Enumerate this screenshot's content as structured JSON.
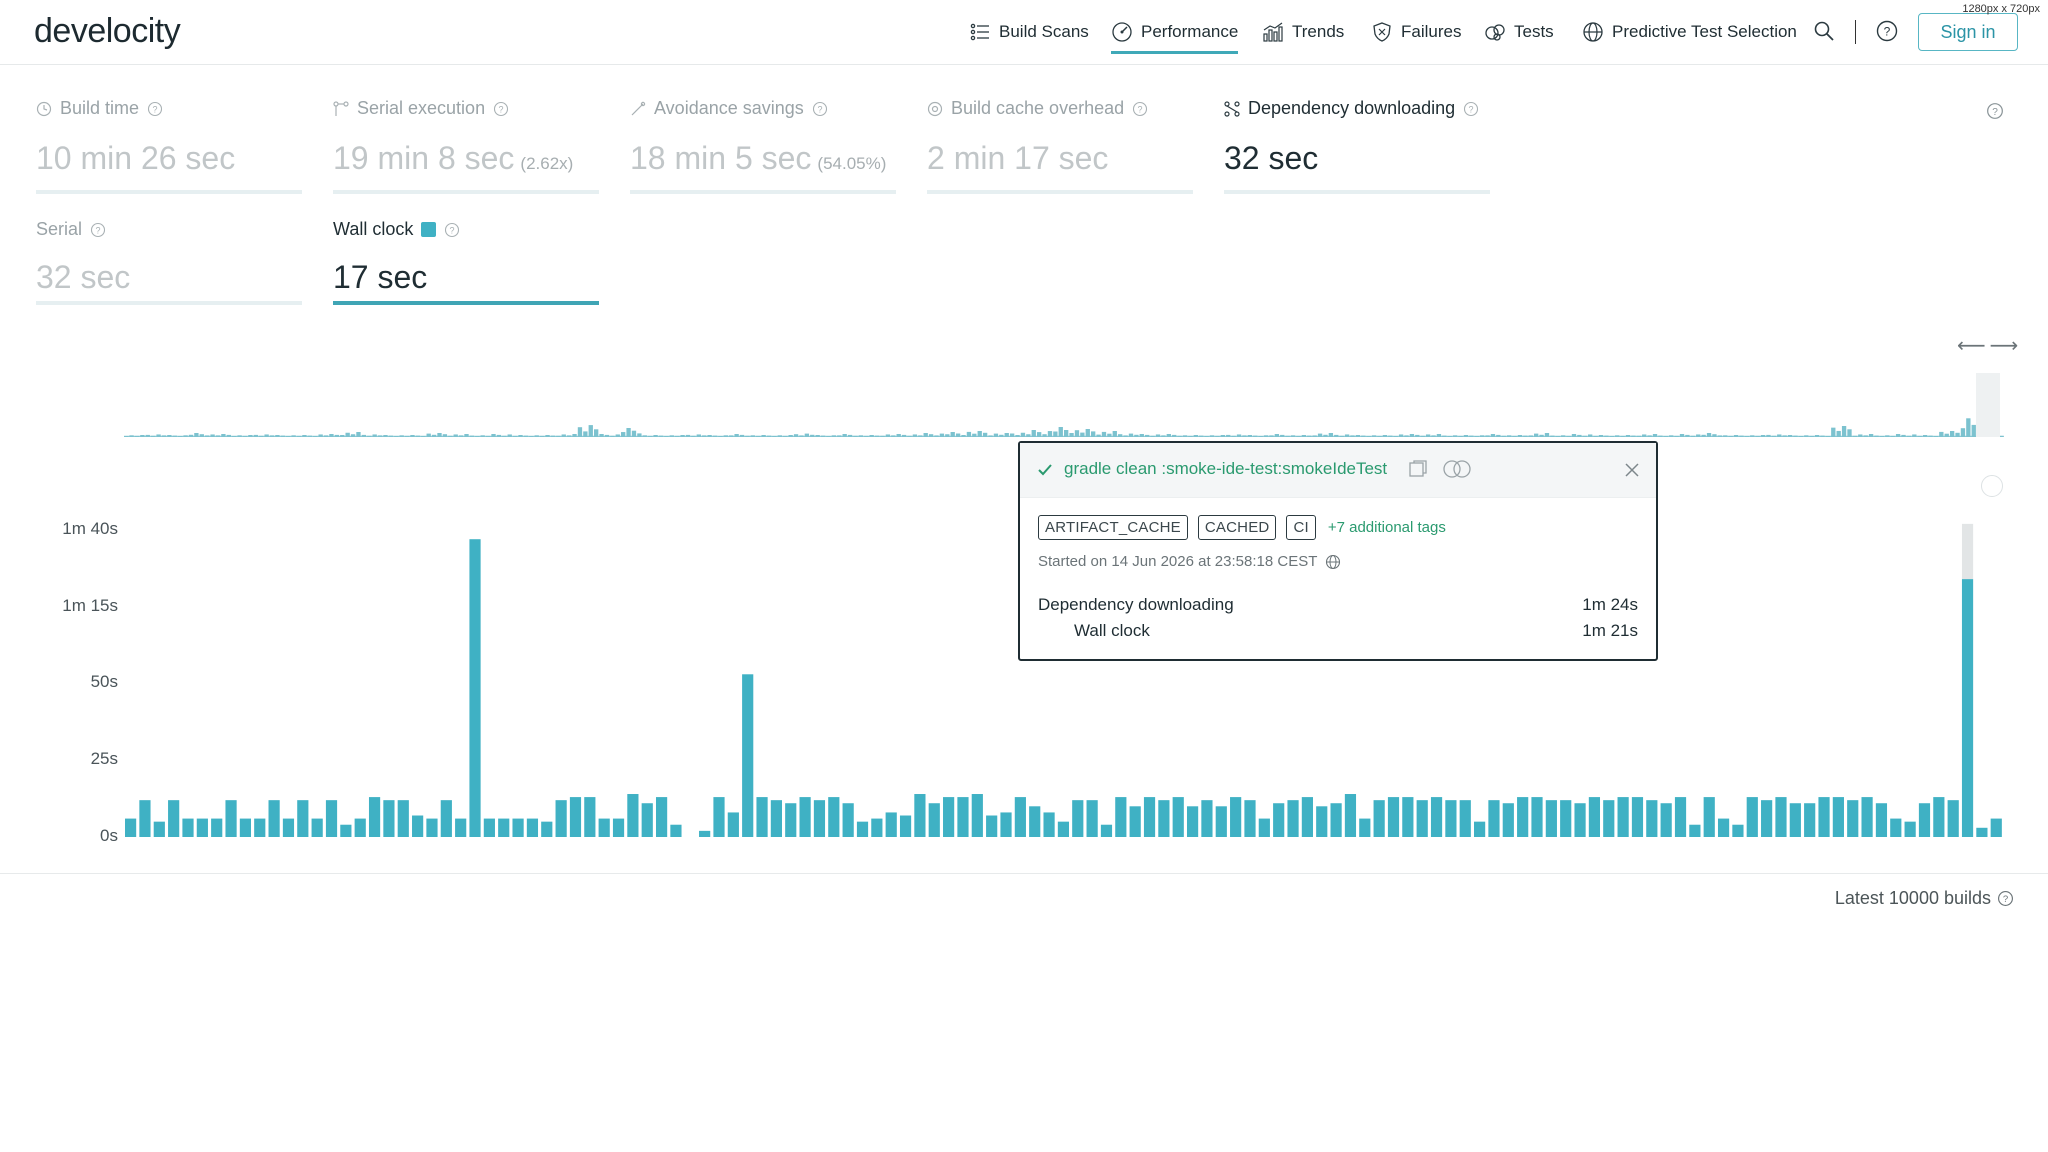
{
  "window": {
    "resolution_label": "1280px x 720px"
  },
  "header": {
    "logo": "develocity",
    "nav": [
      {
        "label": "Build Scans",
        "icon": "list-icon"
      },
      {
        "label": "Performance",
        "icon": "gauge-icon",
        "active": true
      },
      {
        "label": "Trends",
        "icon": "bar-chart-icon"
      },
      {
        "label": "Failures",
        "icon": "shield-icon"
      },
      {
        "label": "Tests",
        "icon": "flask-icon"
      },
      {
        "label": "Predictive Test Selection",
        "icon": "globe-icon"
      }
    ],
    "sign_in": "Sign in"
  },
  "metrics": {
    "build_time": {
      "label": "Build time",
      "value": "10 min 26 sec"
    },
    "serial_execution": {
      "label": "Serial execution",
      "value": "19 min 8 sec",
      "extra": "(2.62x)"
    },
    "avoidance_savings": {
      "label": "Avoidance savings",
      "value": "18 min 5 sec",
      "extra": "(54.05%)"
    },
    "build_cache_overhead": {
      "label": "Build cache overhead",
      "value": "2 min 17 sec"
    },
    "dependency_downloading": {
      "label": "Dependency downloading",
      "value": "32 sec"
    },
    "serial": {
      "label": "Serial",
      "value": "32 sec"
    },
    "wall_clock": {
      "label": "Wall clock",
      "value": "17 sec"
    }
  },
  "chart_data": {
    "type": "bar",
    "title": "",
    "xlabel": "",
    "ylabel": "",
    "ylim": [
      0,
      100
    ],
    "y_ticks": [
      "0s",
      "25s",
      "50s",
      "1m 15s",
      "1m 40s"
    ],
    "series": [
      {
        "name": "Wall clock",
        "values": [
          6,
          12,
          5,
          12,
          6,
          6,
          6,
          12,
          6,
          6,
          12,
          6,
          12,
          6,
          12,
          4,
          6,
          13,
          12,
          12,
          7,
          6,
          12,
          6,
          97,
          6,
          6,
          6,
          6,
          5,
          12,
          13,
          13,
          6,
          6,
          14,
          11,
          13,
          4,
          0,
          2,
          13,
          8,
          53,
          13,
          12,
          11,
          13,
          12,
          13,
          11,
          5,
          6,
          8,
          7,
          14,
          11,
          13,
          13,
          14,
          7,
          8,
          13,
          10,
          8,
          5,
          12,
          12,
          4,
          13,
          10,
          13,
          12,
          13,
          10,
          12,
          10,
          13,
          12,
          6,
          11,
          12,
          13,
          10,
          11,
          14,
          6,
          12,
          13,
          13,
          12,
          13,
          12,
          12,
          5,
          12,
          11,
          13,
          13,
          12,
          12,
          11,
          13,
          12,
          13,
          13,
          12,
          11,
          13,
          4,
          13,
          6,
          4,
          13,
          12,
          13,
          11,
          11,
          13,
          13,
          12,
          13,
          11,
          6,
          5,
          11,
          13,
          12,
          84,
          3,
          6
        ]
      }
    ],
    "cap_values": [
      0,
      0,
      0,
      0,
      0,
      0,
      0,
      0,
      0,
      0,
      0,
      0,
      0,
      0,
      0,
      0,
      0,
      0,
      0,
      0,
      0,
      0,
      0,
      0,
      0,
      0,
      0,
      0,
      0,
      0,
      0,
      0,
      0,
      0,
      0,
      0,
      0,
      0,
      0,
      0,
      0,
      0,
      0,
      0,
      0,
      0,
      0,
      0,
      0,
      0,
      0,
      0,
      0,
      0,
      0,
      0,
      0,
      0,
      0,
      0,
      0,
      0,
      0,
      0,
      0,
      0,
      0,
      0,
      0,
      0,
      0,
      0,
      0,
      0,
      0,
      0,
      0,
      0,
      0,
      0,
      0,
      0,
      0,
      0,
      0,
      0,
      0,
      0,
      0,
      0,
      0,
      0,
      0,
      0,
      0,
      0,
      0,
      0,
      0,
      0,
      0,
      0,
      0,
      0,
      0,
      0,
      0,
      0,
      0,
      0,
      0,
      0,
      0,
      0,
      0,
      0,
      0,
      0,
      0,
      0,
      0,
      0,
      0,
      0,
      0,
      0,
      0,
      0,
      18,
      0,
      0
    ],
    "colors": {
      "bar": "#3fb1c4",
      "cap": "#e2e5e6"
    },
    "footer_note": "Latest 10000 builds"
  },
  "overview": {
    "note": "sparkline of wall clock over latest builds",
    "peaks": [
      2,
      3,
      2,
      4,
      3,
      2,
      3,
      2,
      2,
      3,
      5,
      3,
      2,
      2,
      4,
      3,
      2,
      3,
      2,
      2,
      3,
      14,
      3,
      9,
      2,
      2,
      3,
      2,
      3,
      2,
      2,
      4,
      2,
      3,
      2,
      3,
      3,
      4,
      5,
      6,
      4,
      5,
      7,
      10,
      8,
      6,
      4,
      3,
      3,
      2,
      2,
      3,
      2,
      3,
      2,
      4,
      3,
      2,
      2,
      3,
      3,
      2,
      2,
      3,
      2,
      4,
      2,
      3,
      2,
      2,
      3,
      2,
      3,
      4,
      2,
      2,
      3,
      2,
      2,
      11,
      3,
      2,
      3,
      2,
      6,
      22,
      2
    ]
  },
  "tooltip": {
    "title": "gradle clean :smoke-ide-test:smokeIdeTest",
    "tags": [
      "ARTIFACT_CACHE",
      "CACHED",
      "CI"
    ],
    "more_tags": "+7 additional tags",
    "started": "Started on 14 Jun 2026 at 23:58:18 CEST",
    "rows": [
      {
        "label": "Dependency downloading",
        "value": "1m 24s"
      },
      {
        "label": "Wall clock",
        "value": "1m 21s"
      }
    ]
  }
}
